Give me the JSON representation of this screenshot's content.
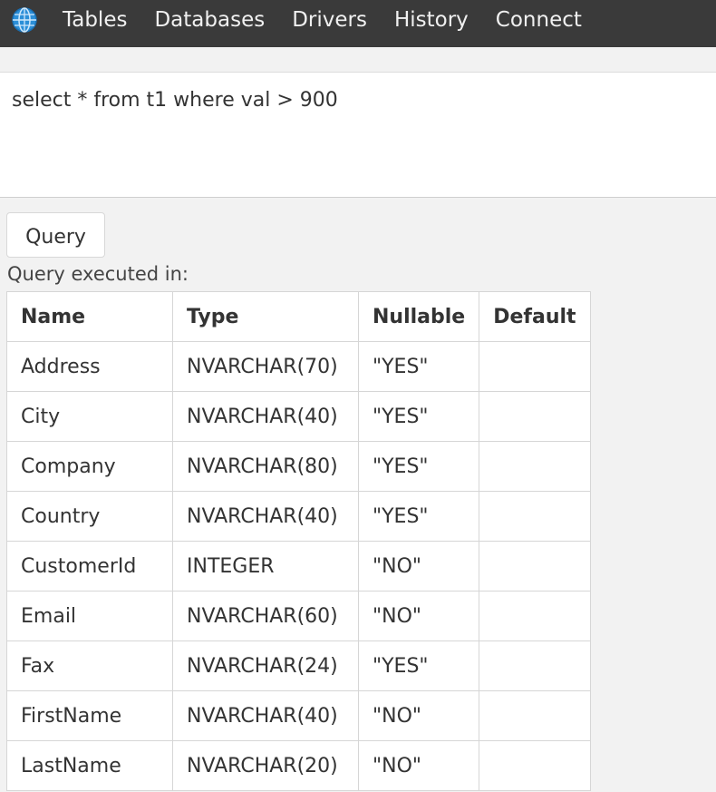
{
  "nav": {
    "icon": "globe-icon",
    "items": [
      "Tables",
      "Databases",
      "Drivers",
      "History",
      "Connect"
    ]
  },
  "editor": {
    "query_text": "select * from t1 where val > 900"
  },
  "query_button": "Query",
  "status": "Query executed in:",
  "table": {
    "headers": [
      "Name",
      "Type",
      "Nullable",
      "Default"
    ],
    "rows": [
      [
        "Address",
        "NVARCHAR(70)",
        "\"YES\"",
        ""
      ],
      [
        "City",
        "NVARCHAR(40)",
        "\"YES\"",
        ""
      ],
      [
        "Company",
        "NVARCHAR(80)",
        "\"YES\"",
        ""
      ],
      [
        "Country",
        "NVARCHAR(40)",
        "\"YES\"",
        ""
      ],
      [
        "CustomerId",
        "INTEGER",
        "\"NO\"",
        ""
      ],
      [
        "Email",
        "NVARCHAR(60)",
        "\"NO\"",
        ""
      ],
      [
        "Fax",
        "NVARCHAR(24)",
        "\"YES\"",
        ""
      ],
      [
        "FirstName",
        "NVARCHAR(40)",
        "\"NO\"",
        ""
      ],
      [
        "LastName",
        "NVARCHAR(20)",
        "\"NO\"",
        ""
      ]
    ]
  }
}
